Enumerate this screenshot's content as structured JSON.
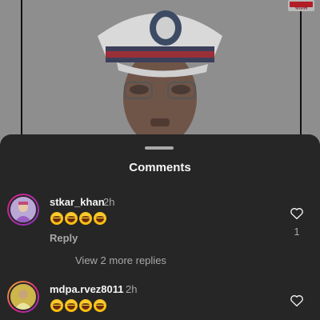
{
  "sheet": {
    "title": "Comments"
  },
  "background": {
    "channel_logo_text": "भारतवर्ष"
  },
  "comments": [
    {
      "username": "stkar_khan",
      "time": "2h",
      "text_emojis": [
        "face-with-tears-of-joy",
        "face-with-tears-of-joy",
        "face-with-tears-of-joy",
        "face-with-tears-of-joy"
      ],
      "reply_label": "Reply",
      "like_count": "1",
      "view_replies_label": "View 2 more replies"
    },
    {
      "username": "mdpa.rvez8011",
      "time": "2h",
      "text_emojis": [
        "face-with-tears-of-joy",
        "face-with-tears-of-joy",
        "face-with-tears-of-joy",
        "face-with-tears-of-joy"
      ]
    }
  ],
  "colors": {
    "sheet_bg": "#262626",
    "primary_text": "#f5f5f5",
    "secondary_text": "#a8a8a8"
  },
  "icons": [
    "heart-outline-icon"
  ]
}
